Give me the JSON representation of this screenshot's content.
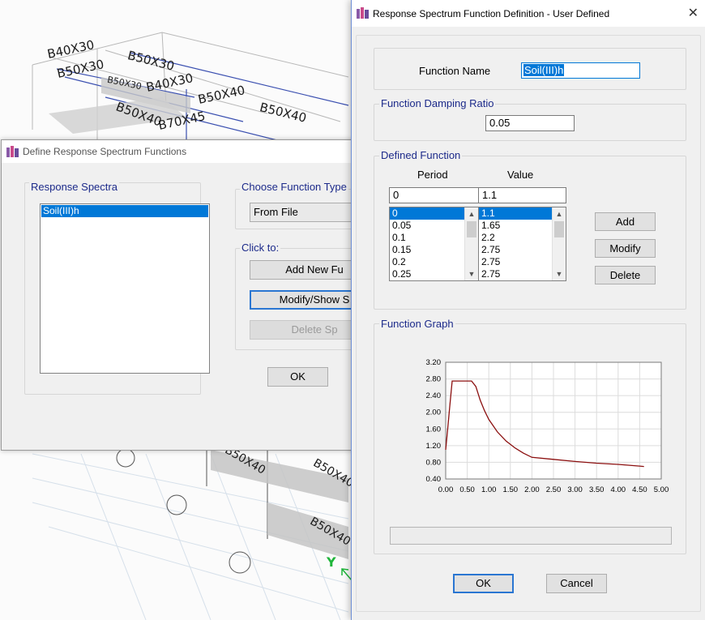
{
  "background": {
    "labels": [
      "B40X30",
      "B50X30",
      "B50X30",
      "B50X30",
      "B40X30",
      "B50X40",
      "B50X40",
      "B70X45",
      "B50X40",
      "B50X40",
      "B50X40",
      "B50X40",
      "Y"
    ],
    "axis_color": "#1fb53a"
  },
  "define_dialog": {
    "title": "Define Response Spectrum Functions",
    "response_spectra_label": "Response Spectra",
    "spectra_items": [
      "Soil(III)h"
    ],
    "choose_type_label": "Choose  Function Type",
    "function_type_value": "From File",
    "click_to_label": "Click to:",
    "add_new_button": "Add New Fu",
    "modify_show_button": "Modify/Show S",
    "delete_button": "Delete Sp",
    "ok_button": "OK"
  },
  "user_defined_dialog": {
    "title": "Response Spectrum Function Definition - User Defined",
    "close_glyph": "✕",
    "function_name_label": "Function Name",
    "function_name_value": "Soil(III)h",
    "damping_label": "Function Damping Ratio",
    "damping_value": "0.05",
    "defined_function_label": "Defined Function",
    "period_header": "Period",
    "value_header": "Value",
    "period_input": "0",
    "value_input": "1.1",
    "period_list": [
      "0",
      "0.05",
      "0.1",
      "0.15",
      "0.2",
      "0.25"
    ],
    "value_list": [
      "1.1",
      "1.65",
      "2.2",
      "2.75",
      "2.75",
      "2.75"
    ],
    "add_button": "Add",
    "modify_button": "Modify",
    "delete_button": "Delete",
    "graph_label": "Function Graph",
    "ok_button": "OK",
    "cancel_button": "Cancel",
    "accent_color": "#1c2a8a",
    "curve_color": "#8b0f0f"
  },
  "chart_data": {
    "type": "line",
    "x_ticks": [
      "0.00",
      "0.50",
      "1.00",
      "1.50",
      "2.00",
      "2.50",
      "3.00",
      "3.50",
      "4.00",
      "4.50",
      "5.00"
    ],
    "y_ticks": [
      "3.20",
      "2.80",
      "2.40",
      "2.00",
      "1.60",
      "1.20",
      "0.80",
      "0.40"
    ],
    "xlim": [
      0,
      5
    ],
    "ylim": [
      0.4,
      3.2
    ],
    "grid": true,
    "series": [
      {
        "x": [
          0,
          0.05,
          0.1,
          0.15,
          0.2,
          0.25,
          0.3,
          0.4,
          0.5,
          0.6,
          0.7,
          0.8,
          0.9,
          1.0,
          1.2,
          1.4,
          1.6,
          1.8,
          2.0,
          2.5,
          3.0,
          3.5,
          4.0,
          4.5,
          4.6
        ],
        "y": [
          1.1,
          1.65,
          2.2,
          2.75,
          2.75,
          2.75,
          2.75,
          2.75,
          2.75,
          2.75,
          2.62,
          2.29,
          2.04,
          1.83,
          1.53,
          1.31,
          1.15,
          1.02,
          0.92,
          0.87,
          0.82,
          0.78,
          0.75,
          0.71,
          0.7
        ]
      }
    ]
  }
}
